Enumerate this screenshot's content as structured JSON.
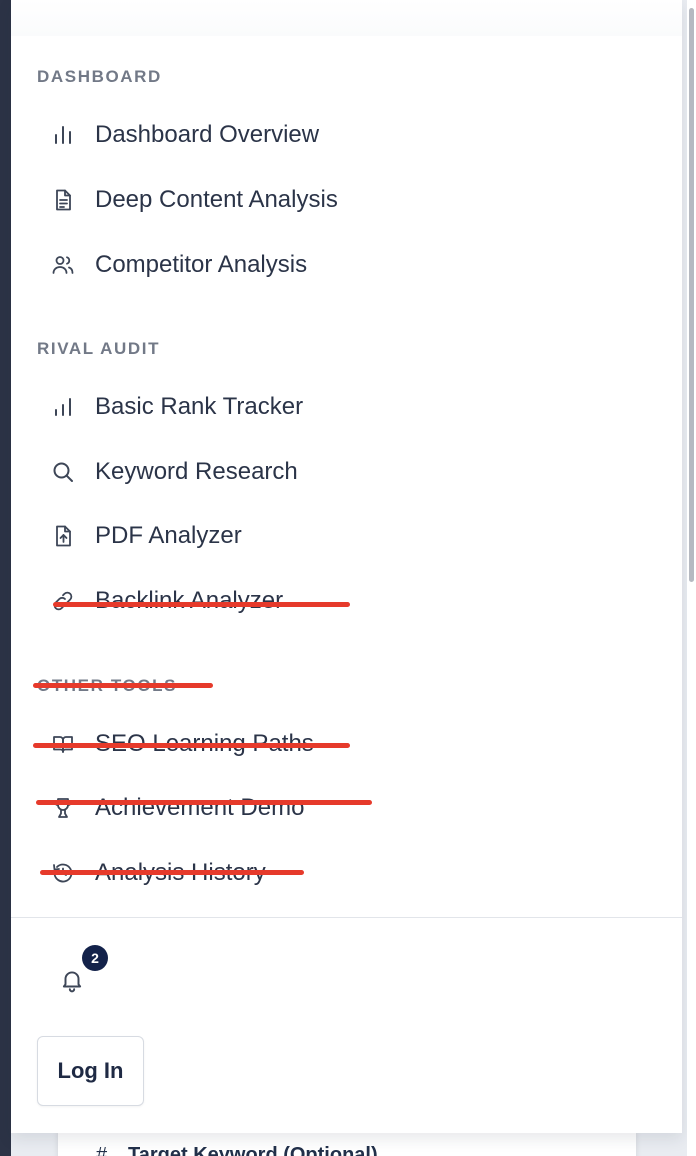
{
  "sections": {
    "dashboard": {
      "title": "DASHBOARD",
      "items": [
        {
          "label": "Dashboard Overview",
          "icon": "bar-chart-icon"
        },
        {
          "label": "Deep Content Analysis",
          "icon": "document-icon"
        },
        {
          "label": "Competitor Analysis",
          "icon": "users-icon"
        }
      ]
    },
    "rival_audit": {
      "title": "RIVAL AUDIT",
      "items": [
        {
          "label": "Basic Rank Tracker",
          "icon": "signal-bars-icon"
        },
        {
          "label": "Keyword Research",
          "icon": "search-icon"
        },
        {
          "label": "PDF Analyzer",
          "icon": "file-upload-icon"
        },
        {
          "label": "Backlink Analyzer",
          "icon": "link-icon",
          "struck_out": true
        }
      ]
    },
    "other_tools": {
      "title": "OTHER TOOLS",
      "struck_out": true,
      "items": [
        {
          "label": "SEO Learning Paths",
          "icon": "book-open-icon",
          "struck_out": true
        },
        {
          "label": "Achievement Demo",
          "icon": "trophy-icon",
          "struck_out": true
        },
        {
          "label": "Analysis History",
          "icon": "history-icon",
          "struck_out": true
        }
      ]
    }
  },
  "footer": {
    "notification_count": "2",
    "login_label": "Log In"
  },
  "background_card": {
    "hash": "#",
    "label": "Target Keyword (Optional)"
  },
  "colors": {
    "strike": "#e63a2b",
    "badge": "#13224a",
    "section_title": "#727987"
  }
}
